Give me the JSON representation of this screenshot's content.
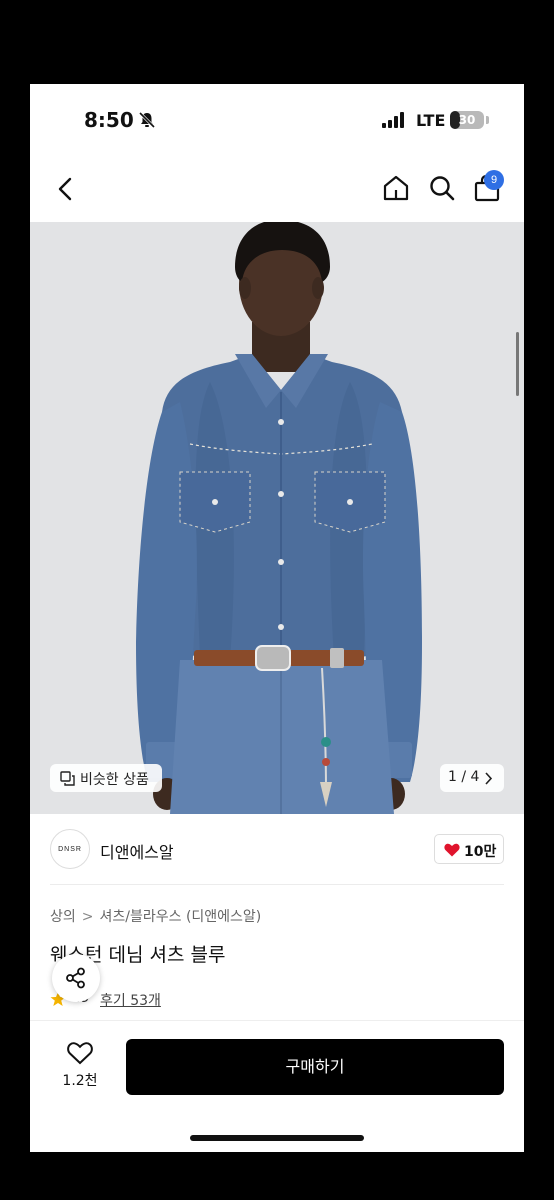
{
  "status_bar": {
    "time": "8:50",
    "network": "LTE",
    "battery": "30",
    "battery_level": 0.3
  },
  "header": {
    "cart_count": "9"
  },
  "hero": {
    "similar_label": "비슷한 상품",
    "page_counter": "1 / 4"
  },
  "brand": {
    "logo_text": "DNSR",
    "name": "디앤에스알",
    "likes": "10만"
  },
  "breadcrumb": [
    "상의",
    "셔츠/블라우스 (디앤에스알)"
  ],
  "product": {
    "title": "웨스턴 데님 셔츠 블루",
    "rating": ".9",
    "reviews": "후기 53개"
  },
  "bottom_bar": {
    "wish_count": "1.2천",
    "buy_label": "구매하기"
  },
  "colors": {
    "badge": "#2f6fe4",
    "heart": "#e0142d",
    "star": "#f5b400",
    "buy_bg": "#000000"
  }
}
